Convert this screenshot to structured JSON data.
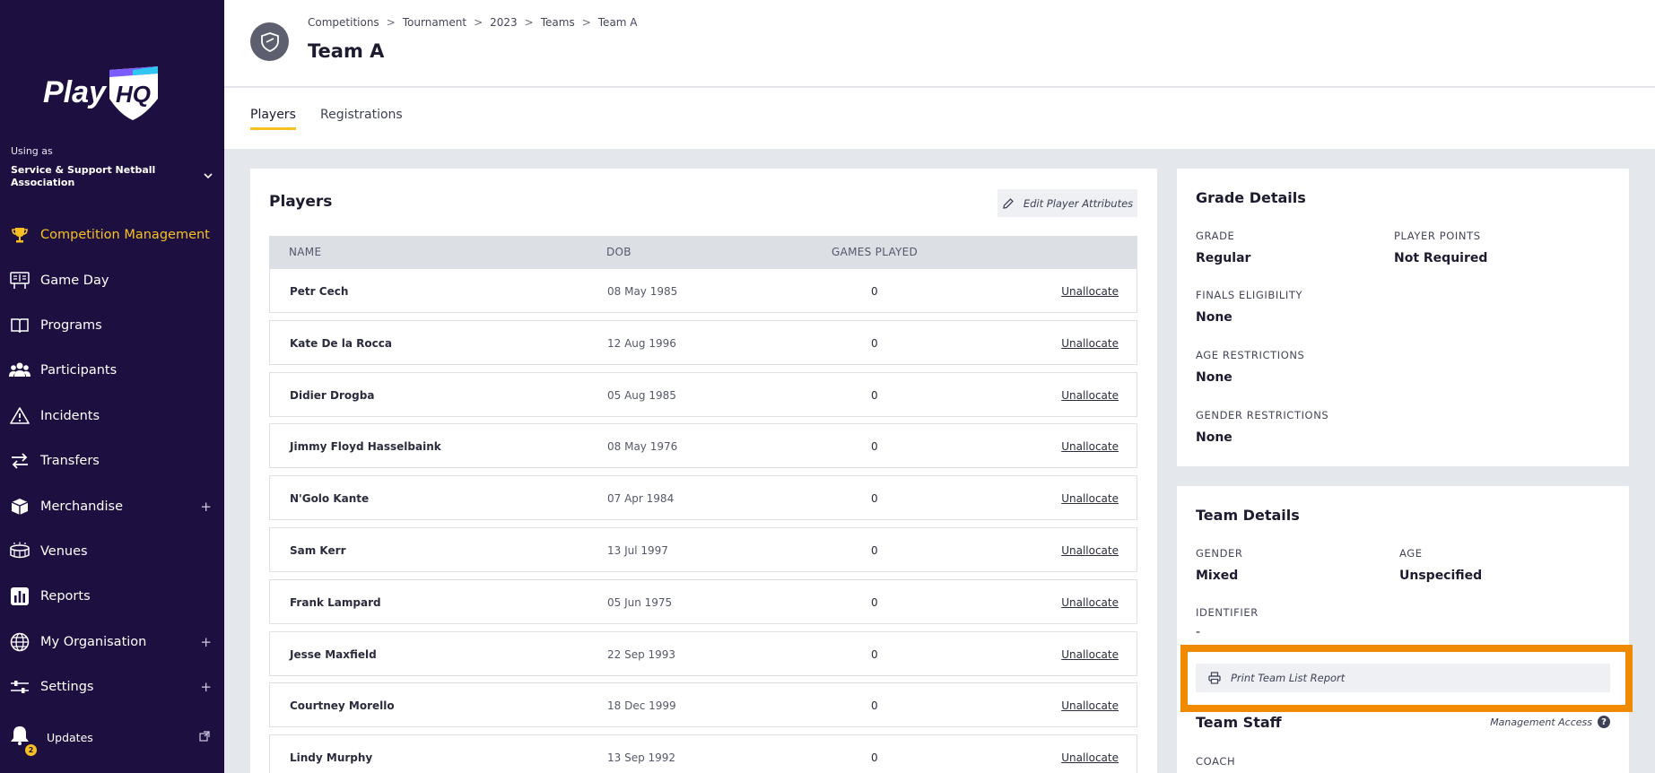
{
  "sidebar": {
    "brand": "PlayHQ",
    "using_as_label": "Using as",
    "org_name": "Service & Support Netball Association",
    "items": [
      {
        "label": "Competition Management",
        "icon": "trophy-icon",
        "active": true
      },
      {
        "label": "Game Day",
        "icon": "scoreboard-icon"
      },
      {
        "label": "Programs",
        "icon": "book-icon"
      },
      {
        "label": "Participants",
        "icon": "people-icon"
      },
      {
        "label": "Incidents",
        "icon": "warning-icon"
      },
      {
        "label": "Transfers",
        "icon": "transfer-arrows-icon"
      },
      {
        "label": "Merchandise",
        "icon": "box-icon",
        "expandable": true
      },
      {
        "label": "Venues",
        "icon": "stadium-icon"
      },
      {
        "label": "Reports",
        "icon": "bar-chart-icon"
      },
      {
        "label": "My Organisation",
        "icon": "globe-icon",
        "expandable": true
      },
      {
        "label": "Settings",
        "icon": "sliders-icon",
        "expandable": true
      }
    ],
    "updates_label": "Updates",
    "updates_count": "2",
    "expand_symbol": "+"
  },
  "header": {
    "breadcrumb": [
      "Competitions",
      "Tournament",
      "2023",
      "Teams",
      "Team A"
    ],
    "breadcrumb_sep": ">",
    "title": "Team A"
  },
  "tabs": [
    {
      "label": "Players",
      "active": true
    },
    {
      "label": "Registrations",
      "active": false
    }
  ],
  "players": {
    "title": "Players",
    "edit_button": "Edit Player Attributes",
    "columns": {
      "name": "NAME",
      "dob": "DOB",
      "games": "GAMES PLAYED"
    },
    "action_label": "Unallocate",
    "rows": [
      {
        "name": "Petr Cech",
        "dob": "08 May 1985",
        "games": "0"
      },
      {
        "name": "Kate De la Rocca",
        "dob": "12 Aug 1996",
        "games": "0"
      },
      {
        "name": "Didier Drogba",
        "dob": "05 Aug 1985",
        "games": "0"
      },
      {
        "name": "Jimmy Floyd Hasselbaink",
        "dob": "08 May 1976",
        "games": "0"
      },
      {
        "name": "N'Golo Kante",
        "dob": "07 Apr 1984",
        "games": "0"
      },
      {
        "name": "Sam Kerr",
        "dob": "13 Jul 1997",
        "games": "0"
      },
      {
        "name": "Frank Lampard",
        "dob": "05 Jun 1975",
        "games": "0"
      },
      {
        "name": "Jesse Maxfield",
        "dob": "22 Sep 1993",
        "games": "0"
      },
      {
        "name": "Courtney Morello",
        "dob": "18 Dec 1999",
        "games": "0"
      },
      {
        "name": "Lindy Murphy",
        "dob": "13 Sep 1992",
        "games": "0"
      }
    ]
  },
  "grade_details": {
    "title": "Grade Details",
    "grade_label": "GRADE",
    "grade_value": "Regular",
    "points_label": "PLAYER POINTS",
    "points_value": "Not Required",
    "finals_label": "FINALS ELIGIBILITY",
    "finals_value": "None",
    "age_label": "AGE RESTRICTIONS",
    "age_value": "None",
    "gender_label": "GENDER RESTRICTIONS",
    "gender_value": "None"
  },
  "team_details": {
    "title": "Team Details",
    "gender_label": "GENDER",
    "gender_value": "Mixed",
    "age_label": "AGE",
    "age_value": "Unspecified",
    "identifier_label": "IDENTIFIER",
    "identifier_value": "-",
    "print_button": "Print Team List Report",
    "staff_title": "Team Staff",
    "management_access": "Management Access",
    "coach_label": "COACH"
  },
  "colors": {
    "sidebar_bg": "#1d1040",
    "accent": "#f7c020",
    "highlight": "#f08a00"
  }
}
